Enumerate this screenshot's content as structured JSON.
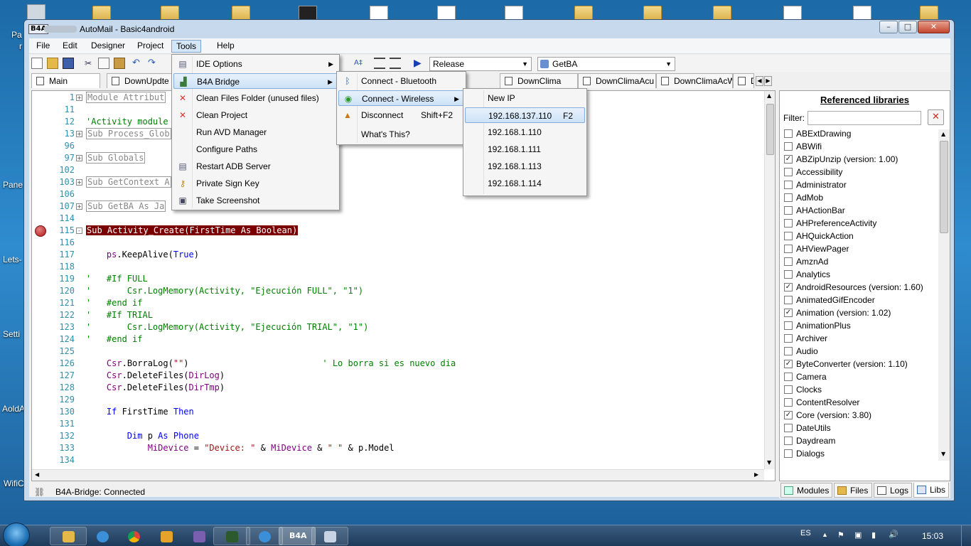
{
  "desktop": {
    "labels": [
      "Pa",
      "r",
      "Pane",
      "Lets-",
      "Setti",
      "AoldA",
      "WifiC"
    ]
  },
  "window": {
    "app_icon": "B4A",
    "title": "AutoMail - Basic4android",
    "buttons": {
      "minimize": "–",
      "maximize": "□",
      "close": "✕"
    }
  },
  "menubar": [
    "File",
    "Edit",
    "Designer",
    "Project",
    "Tools",
    "Help"
  ],
  "toolbar": {
    "build_config": "Release",
    "sub_selector": "GetBA"
  },
  "tabs": [
    "Main",
    "DownUpdte",
    "DownClima",
    "DownClimaAcu",
    "DownClimaAcW",
    "D"
  ],
  "editor": {
    "lines": [
      {
        "n": "1",
        "fold": "+",
        "code": "Module Attribut"
      },
      {
        "n": "11",
        "code": ""
      },
      {
        "n": "12",
        "code": "'Activity module"
      },
      {
        "n": "13",
        "fold": "+",
        "code": "Sub Process_Glob"
      },
      {
        "n": "96",
        "code": ""
      },
      {
        "n": "97",
        "fold": "+",
        "code": "Sub Globals"
      },
      {
        "n": "102",
        "code": ""
      },
      {
        "n": "103",
        "fold": "+",
        "code": "Sub GetContext A"
      },
      {
        "n": "106",
        "code": ""
      },
      {
        "n": "107",
        "fold": "+",
        "code": "Sub GetBA As Ja"
      },
      {
        "n": "114",
        "code": ""
      },
      {
        "n": "115",
        "fold": "-",
        "code": "Sub Activity_Create(FirstTime As Boolean)"
      },
      {
        "n": "116",
        "code": ""
      },
      {
        "n": "117",
        "code": "    ps.KeepAlive(True)"
      },
      {
        "n": "118",
        "code": ""
      },
      {
        "n": "119",
        "code": "'   #If FULL"
      },
      {
        "n": "120",
        "code": "'       Csr.LogMemory(Activity, \"Ejecución FULL\", \"1\")"
      },
      {
        "n": "121",
        "code": "'   #end if"
      },
      {
        "n": "122",
        "code": "'   #If TRIAL"
      },
      {
        "n": "123",
        "code": "'       Csr.LogMemory(Activity, \"Ejecución TRIAL\", \"1\")"
      },
      {
        "n": "124",
        "code": "'   #end if"
      },
      {
        "n": "125",
        "code": ""
      },
      {
        "n": "126",
        "code": "    Csr.BorraLog(\"\")                          ' Lo borra si es nuevo dia"
      },
      {
        "n": "127",
        "code": "    Csr.DeleteFiles(DirLog)"
      },
      {
        "n": "128",
        "code": "    Csr.DeleteFiles(DirTmp)"
      },
      {
        "n": "129",
        "code": ""
      },
      {
        "n": "130",
        "code": "    If FirstTime Then"
      },
      {
        "n": "131",
        "code": ""
      },
      {
        "n": "132",
        "code": "        Dim p As Phone"
      },
      {
        "n": "133",
        "code": "            MiDevice = \"Device: \" & MiDevice & \" \" & p.Model"
      },
      {
        "n": "134",
        "code": ""
      }
    ]
  },
  "libraries": {
    "title": "Referenced libraries",
    "filter_label": "Filter:",
    "filter_value": "",
    "items": [
      {
        "name": "ABExtDrawing",
        "checked": false
      },
      {
        "name": "ABWifi",
        "checked": false
      },
      {
        "name": "ABZipUnzip (version: 1.00)",
        "checked": true
      },
      {
        "name": "Accessibility",
        "checked": false
      },
      {
        "name": "Administrator",
        "checked": false
      },
      {
        "name": "AdMob",
        "checked": false
      },
      {
        "name": "AHActionBar",
        "checked": false
      },
      {
        "name": "AHPreferenceActivity",
        "checked": false
      },
      {
        "name": "AHQuickAction",
        "checked": false
      },
      {
        "name": "AHViewPager",
        "checked": false
      },
      {
        "name": "AmznAd",
        "checked": false
      },
      {
        "name": "Analytics",
        "checked": false
      },
      {
        "name": "AndroidResources (version: 1.60)",
        "checked": true
      },
      {
        "name": "AnimatedGifEncoder",
        "checked": false
      },
      {
        "name": "Animation (version: 1.02)",
        "checked": true
      },
      {
        "name": "AnimationPlus",
        "checked": false
      },
      {
        "name": "Archiver",
        "checked": false
      },
      {
        "name": "Audio",
        "checked": false
      },
      {
        "name": "ByteConverter (version: 1.10)",
        "checked": true
      },
      {
        "name": "Camera",
        "checked": false
      },
      {
        "name": "Clocks",
        "checked": false
      },
      {
        "name": "ContentResolver",
        "checked": false
      },
      {
        "name": "Core (version: 3.80)",
        "checked": true
      },
      {
        "name": "DateUtils",
        "checked": false
      },
      {
        "name": "Daydream",
        "checked": false
      },
      {
        "name": "Dialogs",
        "checked": false
      }
    ]
  },
  "bottom_tabs": [
    "Modules",
    "Files",
    "Logs",
    "Libs"
  ],
  "status": "B4A-Bridge: Connected",
  "tools_menu": [
    {
      "label": "IDE Options",
      "icon": "document-icon",
      "submenu": true
    },
    {
      "label": "B4A Bridge",
      "icon": "bridge-icon",
      "submenu": true,
      "highlight": true
    },
    {
      "label": "Clean Files Folder (unused files)",
      "icon": "red-x-icon"
    },
    {
      "label": "Clean Project",
      "icon": "red-x-icon"
    },
    {
      "label": "Run AVD Manager",
      "icon": ""
    },
    {
      "label": "Configure Paths",
      "icon": ""
    },
    {
      "label": "Restart ADB Server",
      "icon": "document-icon"
    },
    {
      "label": "Private Sign Key",
      "icon": "key-icon"
    },
    {
      "label": "Take Screenshot",
      "icon": "screenshot-icon"
    }
  ],
  "bridge_menu": [
    {
      "label": "Connect - Bluetooth",
      "icon": "bluetooth-icon"
    },
    {
      "label": "Connect - Wireless",
      "icon": "wireless-icon",
      "submenu": true,
      "highlight": true
    },
    {
      "label": "Disconnect",
      "icon": "disconnect-icon",
      "shortcut": "Shift+F2"
    },
    {
      "label": "What's This?",
      "icon": ""
    }
  ],
  "wireless_menu": [
    {
      "label": "New IP"
    },
    {
      "label": "192.168.137.110",
      "shortcut": "F2",
      "highlight": true
    },
    {
      "label": "192.168.1.110"
    },
    {
      "label": "192.168.1.111"
    },
    {
      "label": "192.168.1.113"
    },
    {
      "label": "192.168.1.114"
    }
  ],
  "taskbar": {
    "language": "ES",
    "time": "15:03",
    "app_label": "B4A"
  },
  "colors": {
    "desktop": "#2f8ccf",
    "breakpoint_line": "#7a0000",
    "line_numbers": "#2b91af",
    "keyword": "#0000ff",
    "comment": "#008000",
    "menu_highlight": "#cde2f7"
  }
}
